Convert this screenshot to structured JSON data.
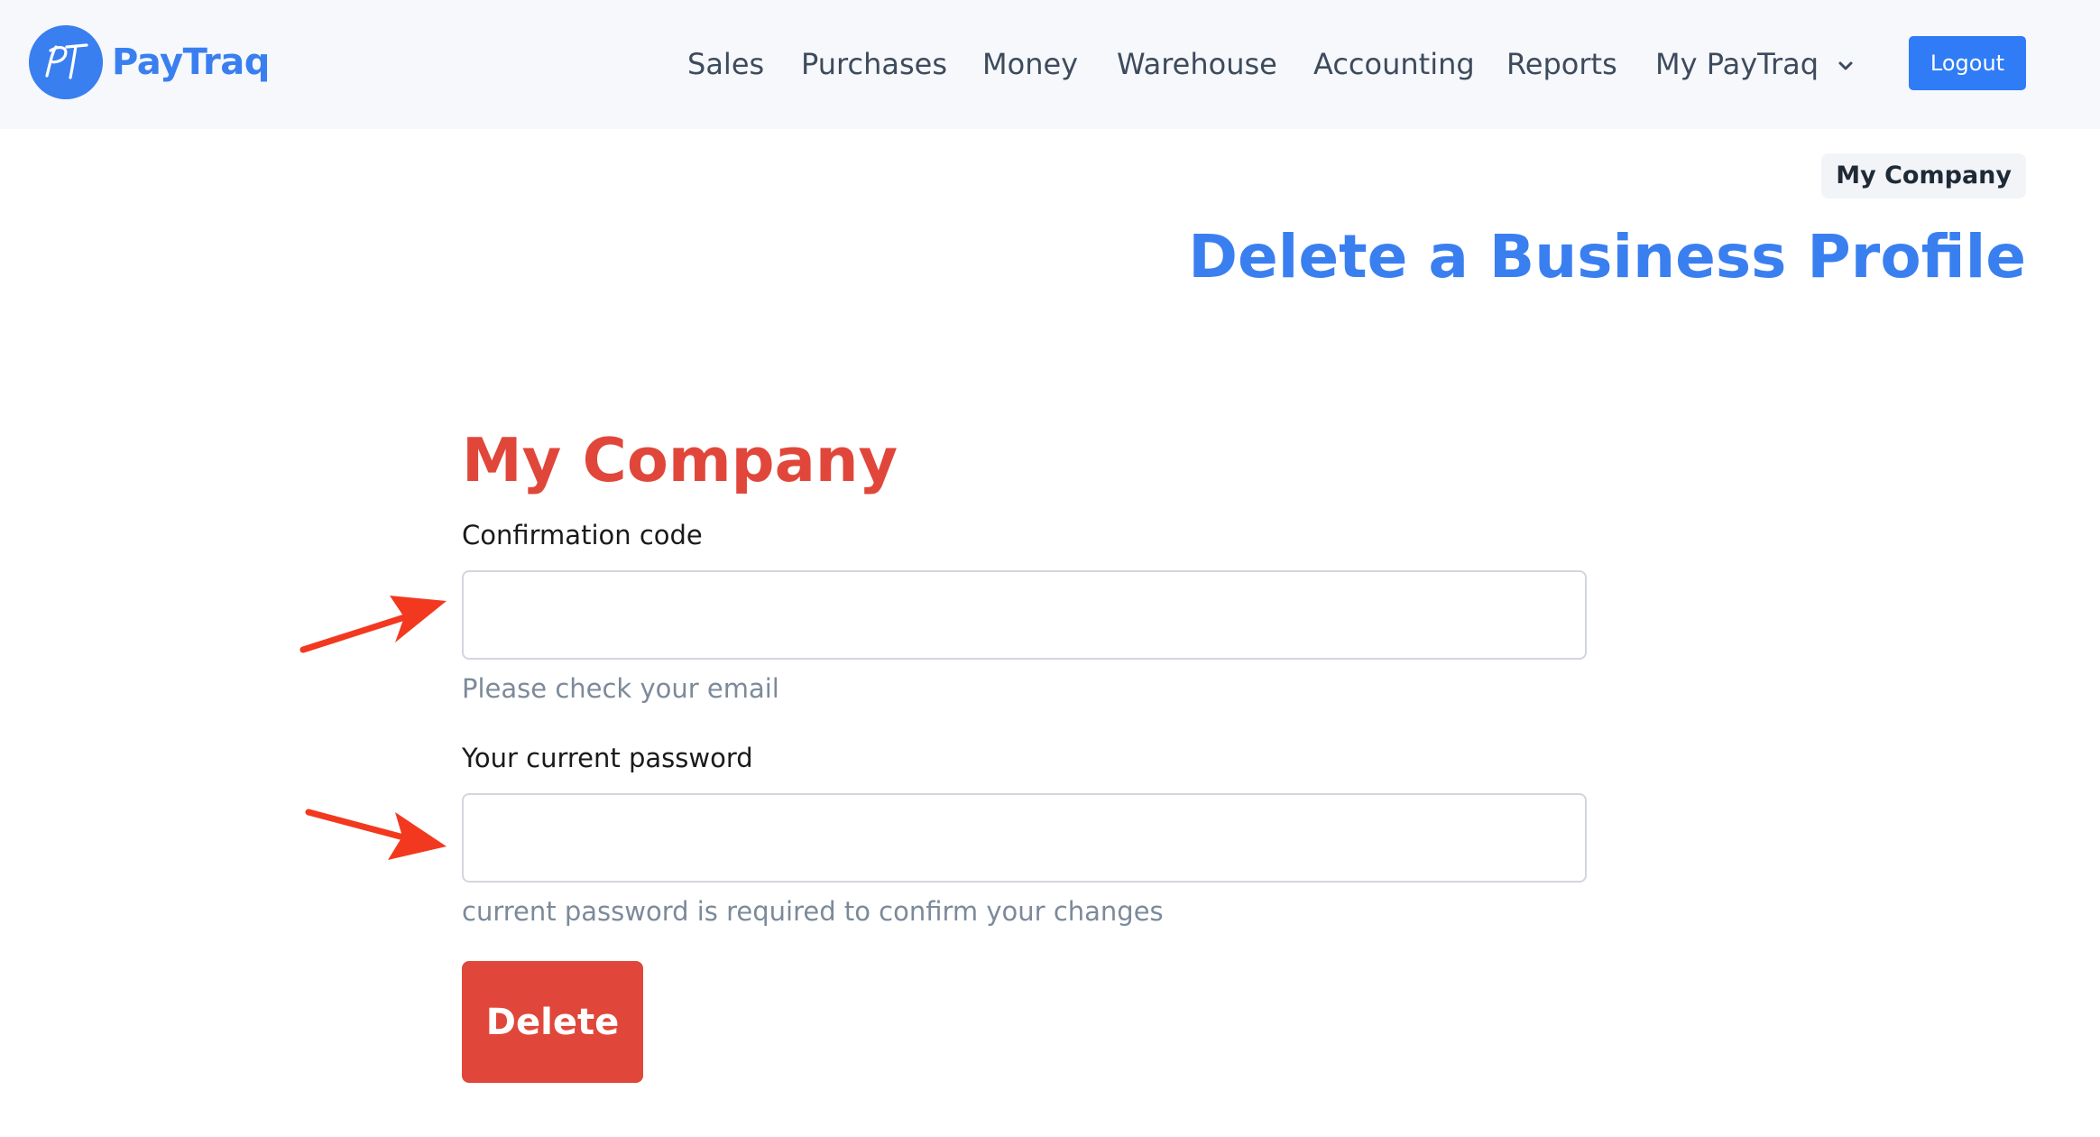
{
  "header": {
    "brand": "PayTraq",
    "nav": [
      {
        "label": "Sales"
      },
      {
        "label": "Purchases"
      },
      {
        "label": "Money"
      },
      {
        "label": "Warehouse"
      },
      {
        "label": "Accounting"
      },
      {
        "label": "Reports"
      },
      {
        "label": "My PayTraq",
        "has_dropdown": true
      }
    ],
    "logout_label": "Logout"
  },
  "breadcrumb_pill": "My Company",
  "page_title": "Delete a Business Profile",
  "form": {
    "company_name": "My Company",
    "confirmation": {
      "label": "Confirmation code",
      "value": "",
      "hint": "Please check your email"
    },
    "password": {
      "label": "Your current password",
      "value": "",
      "hint": "current password is required to confirm your changes"
    },
    "delete_label": "Delete"
  },
  "colors": {
    "brand_blue": "#3a7ff0",
    "logout_blue": "#2f7cf6",
    "danger_red": "#e0473a",
    "annotation_arrow": "#f2391f"
  }
}
